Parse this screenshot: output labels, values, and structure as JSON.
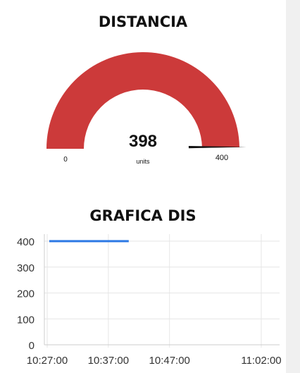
{
  "gauge": {
    "title": "DISTANCIA",
    "value": "398",
    "value_num": 398,
    "units": "units",
    "min": "0",
    "max": "400",
    "min_num": 0,
    "max_num": 400,
    "fill_color": "#cc3a3a",
    "needle_color": "#111111"
  },
  "chart": {
    "title": "GRAFICA DIS"
  },
  "chart_data": {
    "type": "line",
    "title": "GRAFICA DIS",
    "xlabel": "",
    "ylabel": "",
    "ylim": [
      0,
      400
    ],
    "y_ticks": [
      "0",
      "100",
      "200",
      "300",
      "400"
    ],
    "x_ticks": [
      "10:27:00",
      "10:37:00",
      "10:47:00",
      "11:02:00"
    ],
    "x_range": [
      "10:27:00",
      "11:02:00"
    ],
    "grid": true,
    "series": [
      {
        "color": "#2b78e4",
        "x": [
          "10:27:20",
          "10:40:20"
        ],
        "y": [
          400,
          400
        ]
      }
    ]
  }
}
